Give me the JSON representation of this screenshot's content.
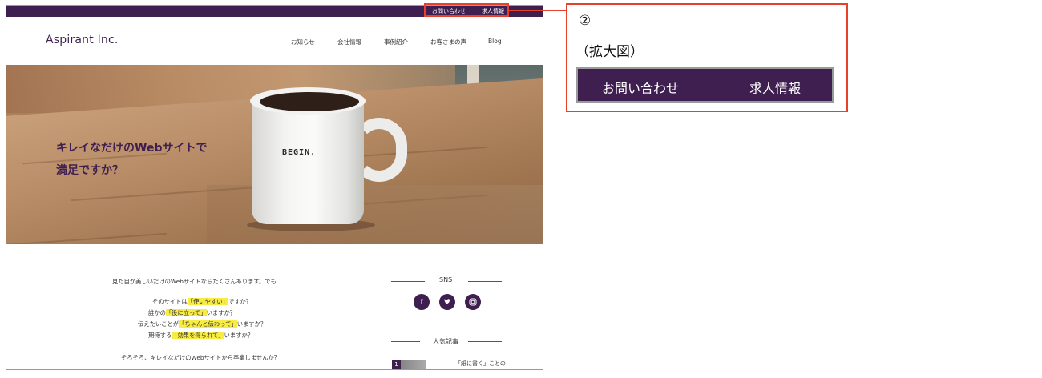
{
  "site": {
    "topbar": {
      "contact": "お問い合わせ",
      "recruit": "求人情報"
    },
    "logo": "Aspirant Inc.",
    "nav": [
      "お知らせ",
      "会社情報",
      "事例紹介",
      "お客さまの声",
      "Blog"
    ],
    "hero": {
      "mug_print": "BEGIN.",
      "copy_line1": "キレイなだけのWebサイトで",
      "copy_line2": "満足ですか？"
    },
    "content": {
      "p0": "見た目が美しいだけのWebサイトならたくさんあります。でも……",
      "p1_pre": "そのサイトは",
      "p1_hl": "「使いやすい」",
      "p1_post": "ですか？",
      "p2_pre": "誰かの",
      "p2_hl": "「役に立って」",
      "p2_post": "いますか？",
      "p3_pre": "伝えたいことが",
      "p3_hl": "「ちゃんと伝わって」",
      "p3_post": "いますか？",
      "p4_pre": "期待する",
      "p4_hl": "「効果を得られて」",
      "p4_post": "いますか？",
      "p5": "そろそろ、キレイなだけのWebサイトから卒業しませんか？"
    },
    "sidebar": {
      "sns_title": "SNS",
      "sns_icons": [
        "facebook-icon",
        "twitter-icon",
        "instagram-icon"
      ],
      "popular_title": "人気記事",
      "popular_rank": "1",
      "popular_item": "「紙に書く」ことの"
    }
  },
  "callout": {
    "number": "②",
    "caption": "（拡大図）",
    "contact": "お問い合わせ",
    "recruit": "求人情報"
  },
  "colors": {
    "brand_purple": "#3f1f50",
    "highlight": "#f7ec43",
    "callout_red": "#e8412b"
  }
}
